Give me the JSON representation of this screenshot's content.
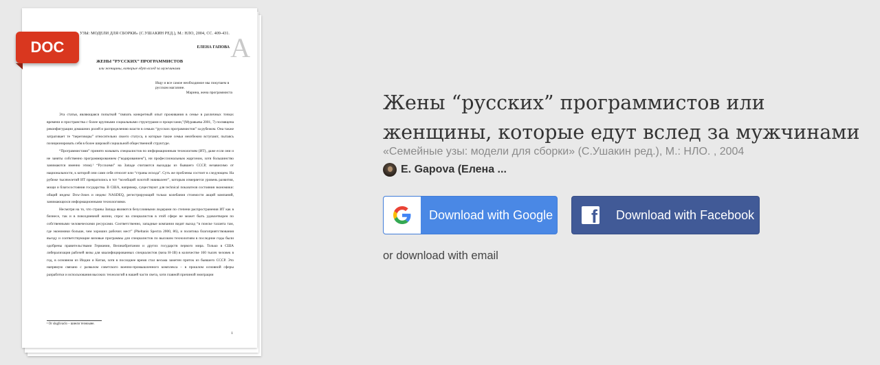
{
  "preview": {
    "badge": "DOC",
    "running_head": "УЗЫ: МОДЕЛИ ДЛЯ СБОРКИ» (С.УШАКИН РЕД.), М.: НЛО, 2004, СС. 409-431.",
    "big_letter": "A",
    "author_line": "ЕЛЕНА ГАПОВА",
    "doc_title": "ЖЕНЫ “РУССКИХ” ПРОГРАММИСТОВ",
    "doc_subtitle": "или женщины, которые едут вслед за мужчинами",
    "epigraph": "Ищу и все самое необходимое мы покупаем в русском магазине.",
    "epigraph_source": "Марина, жена программиста",
    "paragraphs": [
      "Эта статья, являющаяся попыткой “связать конкретный опыт проживания в семье в различных точках времени и пространства с более крупными социальными структурами и процессами,”(Муравьева 2001, 7) посвящена реконфигурации домашних ролей и распределению власти в семьях “русских программистов” за рубежом. Она также затрагивает те “переговоры” относительно своего статуса, в которые такие семьи неизбежно вступают, пытаясь позиционировать себя в более широкой социальной общественной структуре.",
      "“Программистами” принято называть специалистов по информационным технологиям (ИТ), даже если они и не заняты собственно программированием (“кодированием”), ни профессиональным жаргоном, хотя большинство занимаются именно этим).¹ “Русскими” на Западе считаются выходцы из бывшего СССР, независимо от национальности, к которой они сами себя относят или “страны исхода”. Суть же проблемы состоит в следующем. На рубеже тысячелетий ИТ превратились в тот “всеобщий золотой эквивалент”, которым измеряется уровень развития, мощи и благосостояния государства. В США, например, существуют для technical показателя состояния экономики: общий индекс Dow-Jones и индекс NASDEQ, регистрирующий только колебания стоимости акций компаний, занимающихся информационными технологиями.",
      "Несмотря на то, что страны Запада являются безусловными лидерами по степени распространения ИТ как в бизнесе, так и в повседневной жизни, спрос на специалистов в этой сфере не может быть удовлетворен по собственными человеческими ресурсами. Соответственно, западные компании видят выход “в поиске таланта там, где экономики больше, чем хороших рабочих мест” (Pheltanis Spectra 2000, 86), и политика благоприятствования въезду и соответствующие визовые программы для специалистов по высоким технологиям в последние годы были одобрены правительствами Германии, Великобритании и других государств первого мира. Только в США либерализация рабочей визы для квалифицированных специалистов (виза H-1B) в количестве 160 тысяч человек в год, в основном из Индии и Китая, хотя в последнее время стал весьма заметен приток из бывшего СССР. Это напрямую связано с развалом советского военно-промышленного комплекса – в прошлом основной сферы разработки и использования высоких технологий в нашей части света, хотя главной причиной эмиграции"
    ],
    "footnote": "¹ Or sluglivaclo – шиели тезноыне.",
    "page_number": "1"
  },
  "title": "Жены “русских” программистов или женщины, которые едут вслед за мужчинами",
  "source": "«Семейные узы: модели для сборки» (С.Ушакин ред.), М.: НЛО. , 2004",
  "author": "E. Gapova (Елена ...",
  "buttons": {
    "google": "Download with Google",
    "facebook": "Download with Facebook",
    "email": "or download with email"
  },
  "colors": {
    "badge": "#d9371f",
    "google_button": "#4a88e5",
    "facebook_button": "#415a97",
    "background": "#e9e9e9"
  },
  "icons": {
    "google": "google-g-logo",
    "facebook": "facebook-f-logo",
    "avatar": "author-avatar"
  }
}
